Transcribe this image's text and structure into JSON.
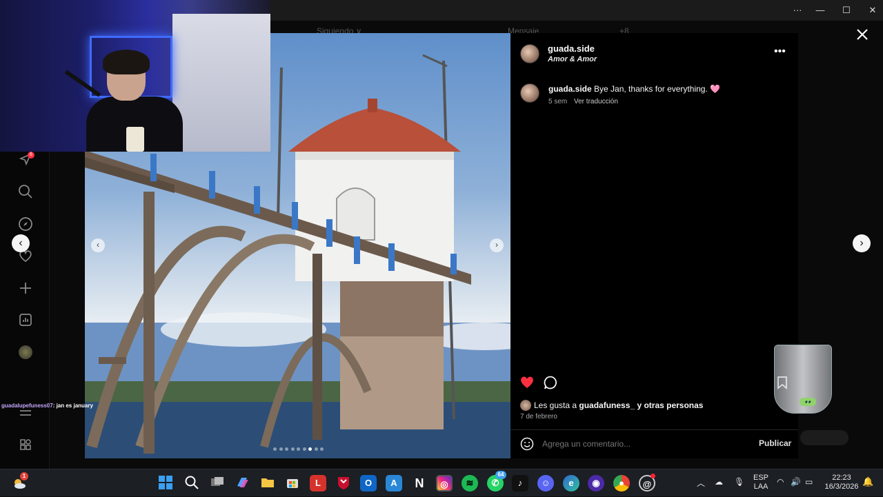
{
  "window": {
    "more_label": "···",
    "minimize_label": "—",
    "maximize_label": "☐",
    "close_label": "✕"
  },
  "ig_topnav": {
    "following_label": "Siguiendo ∨",
    "message_label": "Mensaje",
    "more_count": "+8"
  },
  "sidebar": {
    "items": [
      {
        "icon": "notifications-icon",
        "badge": "6"
      },
      {
        "icon": "search-icon"
      },
      {
        "icon": "explore-icon"
      },
      {
        "icon": "heart-icon"
      },
      {
        "icon": "create-icon"
      },
      {
        "icon": "dashboard-icon"
      },
      {
        "icon": "profile-avatar-icon"
      },
      {
        "icon": "menu-icon"
      },
      {
        "icon": "apps-icon"
      }
    ]
  },
  "chat": {
    "user": "guadalupefuness07",
    "message": ": jan es january"
  },
  "post": {
    "author": "guada.side",
    "audio": "Amor & Amor",
    "caption_author": "guada.side",
    "caption_text": "Bye Jan, thanks for everything. 🩷",
    "caption_age": "5 sem",
    "translate_label": "Ver traducción",
    "likes_prefix": "Les gusta a",
    "likes_user": "guadafuness_",
    "likes_suffix": "y otras personas",
    "date": "7 de febrero",
    "comment_placeholder": "Agrega un comentario...",
    "publish_label": "Publicar",
    "carousel_count": 9,
    "carousel_active": 6
  },
  "taskbar": {
    "weather_badge": "1",
    "whatsapp_badge": "64",
    "lang_top": "ESP",
    "lang_bottom": "LAA",
    "time": "22:23",
    "date": "16/3/2026"
  },
  "colors": {
    "like_red": "#ff3040",
    "modal_bg": "#000000",
    "accent_blue": "#0095f6"
  }
}
